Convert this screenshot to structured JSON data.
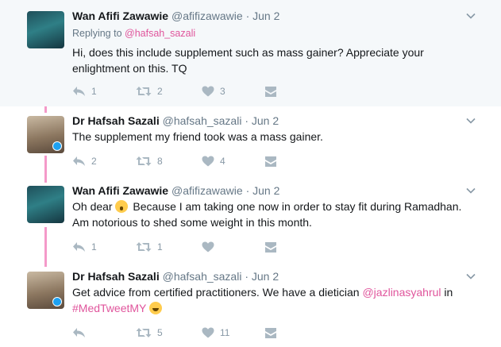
{
  "tweets": [
    {
      "name": "Wan Afifi Zawawie",
      "handle": "@afifizawawie",
      "sep": "·",
      "date": "Jun 2",
      "replying_prefix": "Replying to ",
      "replying_to": "@hafsah_sazali",
      "text": "Hi, does this include supplement such as mass gainer? Appreciate your enlightment on this. TQ",
      "replies": "1",
      "retweets": "2",
      "likes": "3"
    },
    {
      "name": "Dr Hafsah Sazali",
      "handle": "@hafsah_sazali",
      "sep": "·",
      "date": "Jun 2",
      "text": "The supplement my friend took was a mass gainer.",
      "replies": "2",
      "retweets": "8",
      "likes": "4"
    },
    {
      "name": "Wan Afifi Zawawie",
      "handle": "@afifizawawie",
      "sep": "·",
      "date": "Jun 2",
      "text_a": "Oh dear",
      "text_b": " Because I am taking one now in order to stay fit during Ramadhan. Am notorious to shed some weight in this month.",
      "replies": "1",
      "retweets": "1",
      "likes": ""
    },
    {
      "name": "Dr Hafsah Sazali",
      "handle": "@hafsah_sazali",
      "sep": "·",
      "date": "Jun 2",
      "text_a": "Get advice from certified practitioners. We have a dietician ",
      "mention": "@jazlinasyahrul",
      "text_b": " in ",
      "hashtag": "#MedTweetMY",
      "replies": "",
      "retweets": "5",
      "likes": "11"
    }
  ],
  "icons": {
    "reply": "reply-icon",
    "retweet": "retweet-icon",
    "like": "heart-icon",
    "dm": "direct-message-icon",
    "caret": "chevron-down-icon",
    "verified": "verified-badge-icon"
  },
  "colors": {
    "thread_line": "#f49ac9",
    "mention": "#e0559c",
    "muted": "#657786",
    "highlight_bg": "#f5f8fa"
  }
}
